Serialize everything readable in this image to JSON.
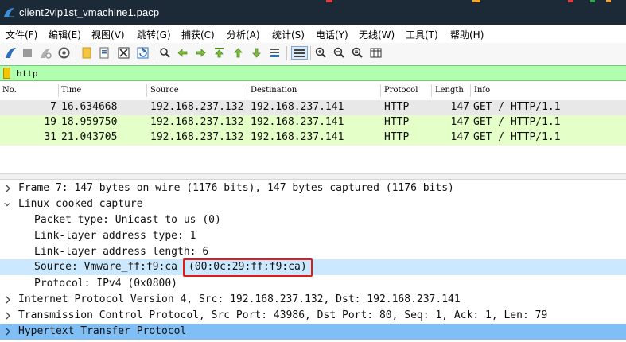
{
  "window": {
    "title": "client2vip1st_vmachine1.pacp"
  },
  "menu": [
    {
      "label": "文件(F)"
    },
    {
      "label": "编辑(E)"
    },
    {
      "label": "视图(V)"
    },
    {
      "label": "跳转(G)"
    },
    {
      "label": "捕获(C)"
    },
    {
      "label": "分析(A)"
    },
    {
      "label": "统计(S)"
    },
    {
      "label": "电话(Y)"
    },
    {
      "label": "无线(W)"
    },
    {
      "label": "工具(T)"
    },
    {
      "label": "帮助(H)"
    }
  ],
  "toolbar": {
    "icons": [
      "shark-fin-start-icon",
      "stop-square-icon",
      "restart-fin-icon",
      "capture-options-icon",
      "open-folder-icon",
      "file-icon",
      "close-file-icon",
      "reload-icon",
      "find-icon",
      "go-back-icon",
      "go-forward-icon",
      "go-to-packet-icon",
      "first-packet-icon",
      "last-packet-icon",
      "autoscroll-icon",
      "colorize-icon",
      "zoom-in-icon",
      "zoom-out-icon",
      "normal-size-icon",
      "resize-columns-icon"
    ]
  },
  "filter": {
    "value": "http"
  },
  "packet_list": {
    "columns": [
      "No.",
      "Time",
      "Source",
      "Destination",
      "Protocol",
      "Length",
      "Info"
    ],
    "rows": [
      {
        "no": "7",
        "time": "16.634668",
        "source": "192.168.237.132",
        "destination": "192.168.237.141",
        "protocol": "HTTP",
        "length": "147",
        "info": "GET / HTTP/1.1"
      },
      {
        "no": "19",
        "time": "18.959750",
        "source": "192.168.237.132",
        "destination": "192.168.237.141",
        "protocol": "HTTP",
        "length": "147",
        "info": "GET / HTTP/1.1"
      },
      {
        "no": "31",
        "time": "21.043705",
        "source": "192.168.237.132",
        "destination": "192.168.237.141",
        "protocol": "HTTP",
        "length": "147",
        "info": "GET / HTTP/1.1"
      }
    ]
  },
  "details": {
    "lines": [
      {
        "text": "Frame 7: 147 bytes on wire (1176 bits), 147 bytes captured (1176 bits)",
        "state": "collapsed"
      },
      {
        "text": "Linux cooked capture",
        "state": "expanded"
      },
      {
        "text": "Packet type: Unicast to us (0)",
        "state": "leaf"
      },
      {
        "text": "Link-layer address type: 1",
        "state": "leaf"
      },
      {
        "text": "Link-layer address length: 6",
        "state": "leaf"
      },
      {
        "text": "Source: Vmware_ff:f9:ca",
        "text_highlighted": "(00:0c:29:ff:f9:ca)",
        "state": "leaf-selected"
      },
      {
        "text": "Protocol: IPv4 (0x0800)",
        "state": "leaf"
      },
      {
        "text": "Internet Protocol Version 4, Src: 192.168.237.132, Dst: 192.168.237.141",
        "state": "collapsed"
      },
      {
        "text": "Transmission Control Protocol, Src Port: 43986, Dst Port: 80, Seq: 1, Ack: 1, Len: 79",
        "state": "collapsed"
      },
      {
        "text": "Hypertext Transfer Protocol",
        "state": "collapsed-selected"
      }
    ]
  },
  "colors": {
    "titlebar": "#1c2a38",
    "filter_bg": "#afffaf",
    "row_http_bg": "#e4ffc7",
    "row_selected_bg": "#e8e8e8",
    "detail_selected_bg": "#cce8ff",
    "detail_bottom_selected_bg": "#7fbff5",
    "highlight_box": "#e01b1b"
  }
}
